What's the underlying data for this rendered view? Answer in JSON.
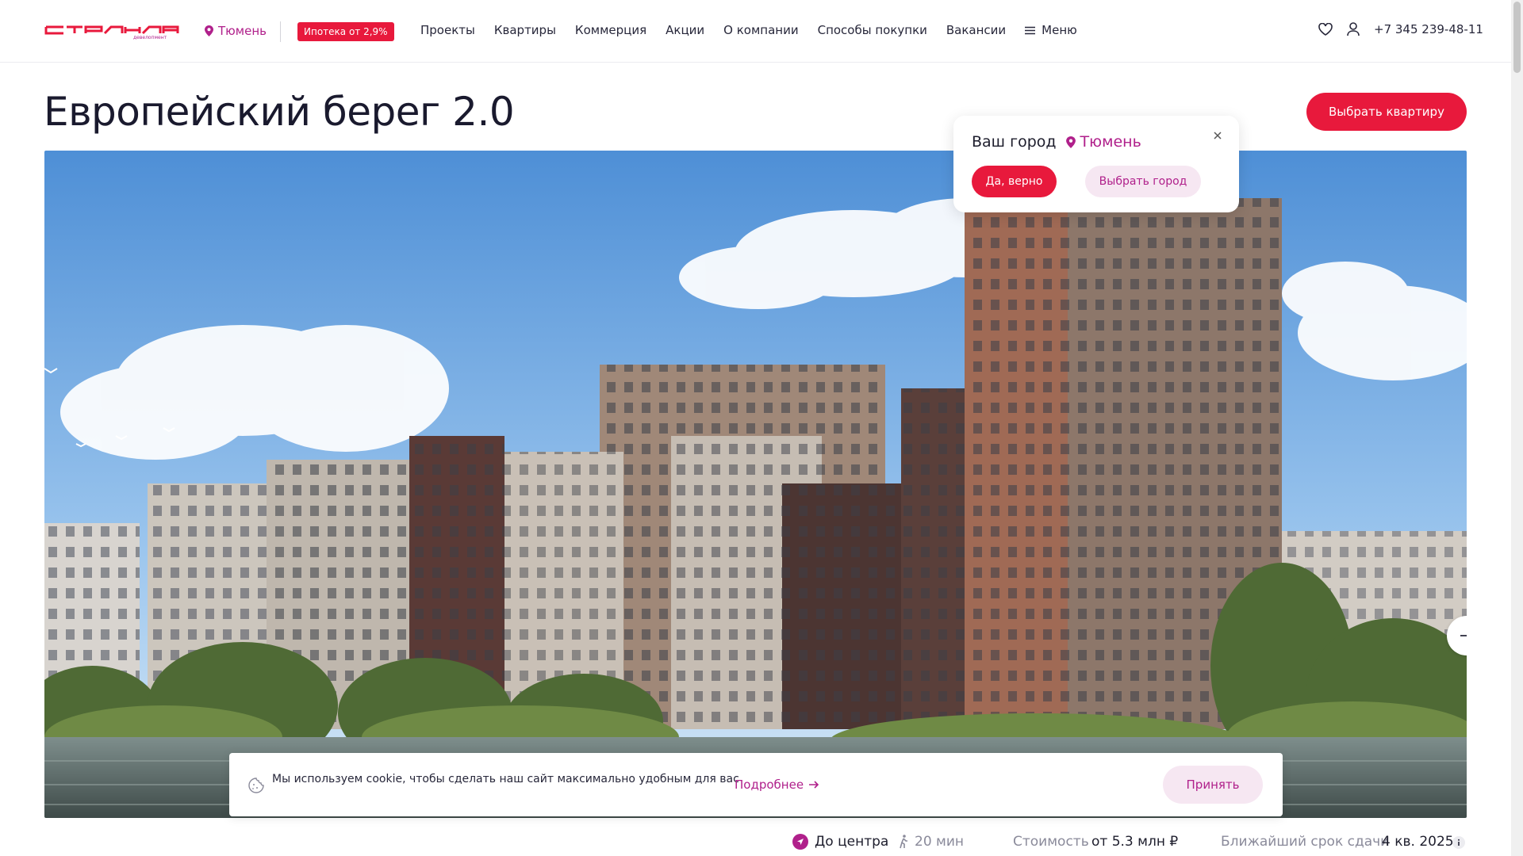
{
  "header": {
    "logo_text": "страна девелопмент",
    "city": "Тюмень",
    "mortgage_badge": "Ипотека от 2,9%",
    "nav": [
      "Проекты",
      "Квартиры",
      "Коммерция",
      "Акции",
      "О компании",
      "Способы покупки",
      "Вакансии"
    ],
    "menu_label": "Меню",
    "phone": "+7 345 239-48-11",
    "icons": [
      "heart-icon",
      "user-icon",
      "pin-icon",
      "hamburger-icon"
    ]
  },
  "project": {
    "title": "Европейский берег 2.0",
    "choose_button": "Выбрать квартиру"
  },
  "hero": {
    "next_icon": "arrow-right-icon"
  },
  "city_popup": {
    "title": "Ваш город",
    "city": "Тюмень",
    "yes_button": "Да, верно",
    "choose_button": "Выбрать город",
    "close_icon": "close-icon"
  },
  "cookie": {
    "text": "Мы используем cookie, чтобы сделать наш сайт максимально удобным для вас",
    "more_link": "Подробнее",
    "accept_button": "Принять",
    "icon": "cookie-icon"
  },
  "info": {
    "to_center_label": "До центра",
    "walk_time": "20 мин",
    "price_label": "Стоимость",
    "price_value": "от 5.3 млн ₽",
    "deadline_label": "Ближайший срок сдачи",
    "deadline_value": "4 кв. 2025"
  },
  "colors": {
    "accent_red": "#e8193c",
    "accent_magenta": "#b0208b",
    "soft_pink": "#f6e7f2",
    "text_dark": "#1d1d2c"
  }
}
